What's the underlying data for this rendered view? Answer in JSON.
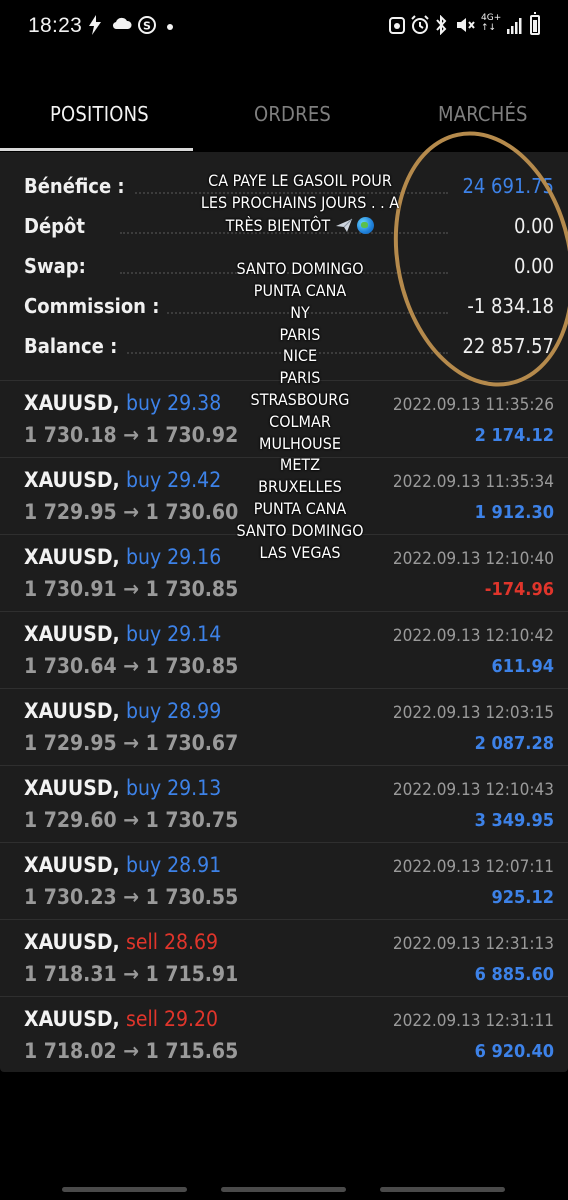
{
  "status_bar": {
    "time": "18:23",
    "left_icons": [
      "flash-icon",
      "cloud-icon",
      "skype-icon"
    ],
    "right_icons": [
      "alarm-clock-icon",
      "alarm-icon",
      "bluetooth-icon",
      "mute-icon"
    ],
    "network_line1": "4G+",
    "network_line2": "↑↓",
    "battery_level": 0.75
  },
  "tabs": [
    {
      "label": "POSITIONS",
      "active": true
    },
    {
      "label": "ORDRES",
      "active": false
    },
    {
      "label": "MARCHÉS",
      "active": false
    }
  ],
  "summary": {
    "profit_label": "Bénéfice :",
    "profit_value": "24 691.75",
    "deposit_label": "Dépôt",
    "deposit_value": "0.00",
    "swap_label": "Swap:",
    "swap_value": "0.00",
    "commission_label": "Commission :",
    "commission_value": "-1 834.18",
    "balance_label": "Balance :",
    "balance_value": "22 857.57"
  },
  "positions": [
    {
      "symbol": "XAUUSD,",
      "side": "buy",
      "volume": "buy 29.38",
      "prices": "1 730.18 → 1 730.92",
      "time": "2022.09.13 11:35:26",
      "profit": "2 174.12"
    },
    {
      "symbol": "XAUUSD,",
      "side": "buy",
      "volume": "buy 29.42",
      "prices": "1 729.95 → 1 730.60",
      "time": "2022.09.13 11:35:34",
      "profit": "1 912.30"
    },
    {
      "symbol": "XAUUSD,",
      "side": "buy",
      "volume": "buy 29.16",
      "prices": "1 730.91 → 1 730.85",
      "time": "2022.09.13 12:10:40",
      "profit": "-174.96"
    },
    {
      "symbol": "XAUUSD,",
      "side": "buy",
      "volume": "buy 29.14",
      "prices": "1 730.64 → 1 730.85",
      "time": "2022.09.13 12:10:42",
      "profit": "611.94"
    },
    {
      "symbol": "XAUUSD,",
      "side": "buy",
      "volume": "buy 28.99",
      "prices": "1 729.95 → 1 730.67",
      "time": "2022.09.13 12:03:15",
      "profit": "2 087.28"
    },
    {
      "symbol": "XAUUSD,",
      "side": "buy",
      "volume": "buy 29.13",
      "prices": "1 729.60 → 1 730.75",
      "time": "2022.09.13 12:10:43",
      "profit": "3 349.95"
    },
    {
      "symbol": "XAUUSD,",
      "side": "buy",
      "volume": "buy 28.91",
      "prices": "1 730.23 → 1 730.55",
      "time": "2022.09.13 12:07:11",
      "profit": "925.12"
    },
    {
      "symbol": "XAUUSD,",
      "side": "sell",
      "volume": "sell 28.69",
      "prices": "1 718.31 → 1 715.91",
      "time": "2022.09.13 12:31:13",
      "profit": "6 885.60"
    },
    {
      "symbol": "XAUUSD,",
      "side": "sell",
      "volume": "sell 29.20",
      "prices": "1 718.02 → 1 715.65",
      "time": "2022.09.13 12:31:11",
      "profit": "6 920.40"
    }
  ],
  "overlay": {
    "lines": [
      "CA PAYE LE GASOIL POUR",
      "LES PROCHAINS JOURS . . A",
      "TRÈS BIENTÔT",
      "",
      "SANTO DOMINGO",
      "PUNTA CANA",
      "NY",
      "PARIS",
      "NICE",
      "PARIS",
      "STRASBOURG",
      "COLMAR",
      "MULHOUSE",
      "METZ",
      "BRUXELLES",
      "PUNTA CANA",
      "SANTO DOMINGO",
      "LAS VEGAS"
    ],
    "emoji_icons": [
      "airplane-icon",
      "globe-icon"
    ],
    "circle_color": "#b58a4c"
  },
  "colors": {
    "accent_blue": "#3d82e8",
    "loss_red": "#e0352b",
    "panel_bg": "#1d1d1d"
  }
}
